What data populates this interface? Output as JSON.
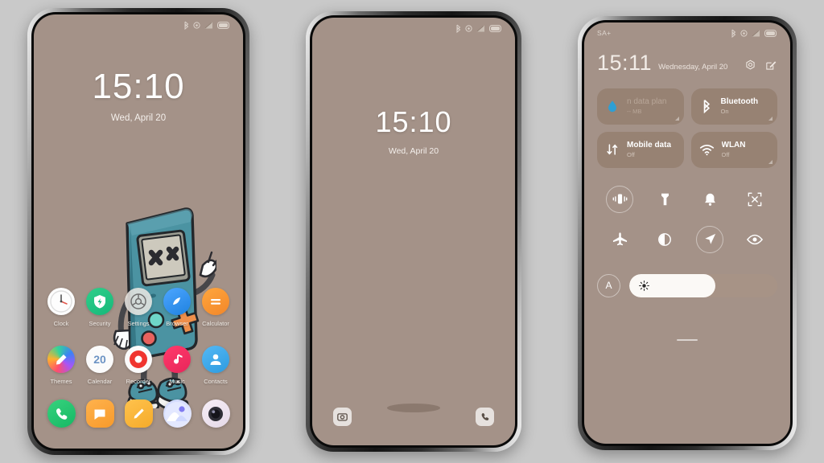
{
  "theme": {
    "page_bg": "#c9c9c9",
    "wallpaper": "#a49288",
    "accent_teal": "#3f8fa0",
    "accent_orange": "#e8823c"
  },
  "phone1": {
    "name": "home-screen",
    "statusbar": {
      "carrier": "",
      "icons": [
        "bluetooth-icon",
        "alarm-icon",
        "signal-icon",
        "battery-icon"
      ]
    },
    "clock": {
      "time": "15:10",
      "date": "Wed, April 20"
    },
    "apps_row1": [
      {
        "label": "Clock",
        "icon": "clock-icon"
      },
      {
        "label": "Security",
        "icon": "security-shield-icon"
      },
      {
        "label": "Settings",
        "icon": "settings-gear-icon"
      },
      {
        "label": "Browser",
        "icon": "browser-compass-icon"
      },
      {
        "label": "Calculator",
        "icon": "calculator-icon"
      }
    ],
    "apps_row2": [
      {
        "label": "Themes",
        "icon": "themes-brush-icon"
      },
      {
        "label": "Calendar",
        "icon": "calendar-icon",
        "day": "20"
      },
      {
        "label": "Recorder",
        "icon": "recorder-icon"
      },
      {
        "label": "Music",
        "icon": "music-note-icon"
      },
      {
        "label": "Contacts",
        "icon": "contacts-person-icon"
      }
    ],
    "dock": [
      {
        "label": "Phone",
        "icon": "phone-handset-icon"
      },
      {
        "label": "Messages",
        "icon": "message-bubble-icon"
      },
      {
        "label": "Notes",
        "icon": "notes-pencil-icon"
      },
      {
        "label": "Gallery",
        "icon": "gallery-mountain-icon"
      },
      {
        "label": "Camera",
        "icon": "camera-lens-icon"
      }
    ]
  },
  "phone2": {
    "name": "lock-screen",
    "statusbar": {
      "carrier": "",
      "icons": [
        "bluetooth-icon",
        "alarm-icon",
        "signal-icon",
        "battery-icon"
      ]
    },
    "clock": {
      "time": "15:10",
      "date": "Wed, April 20"
    },
    "shortcuts": [
      {
        "label": "Camera",
        "icon": "camera-icon"
      },
      {
        "label": "Phone",
        "icon": "phone-handset-icon"
      }
    ]
  },
  "phone3": {
    "name": "control-center",
    "statusbar": {
      "carrier": "SA+",
      "icons": [
        "bluetooth-icon",
        "alarm-icon",
        "signal-icon",
        "battery-icon"
      ]
    },
    "header": {
      "time": "15:11",
      "date": "Wednesday, April 20",
      "settings_icon": "gear-icon",
      "edit_icon": "edit-pencil-icon"
    },
    "tiles": [
      {
        "name": "n data plan",
        "sub": "-- MB",
        "icon": "data-drop-icon",
        "state": "off"
      },
      {
        "name": "Bluetooth",
        "sub": "On",
        "icon": "bluetooth-icon",
        "state": "on"
      },
      {
        "name": "Mobile data",
        "sub": "Off",
        "icon": "mobile-data-arrows-icon",
        "state": "off"
      },
      {
        "name": "WLAN",
        "sub": "Off",
        "icon": "wifi-icon",
        "state": "off"
      }
    ],
    "toggles": [
      {
        "name": "vibrate-icon",
        "active": true
      },
      {
        "name": "flashlight-icon",
        "active": false
      },
      {
        "name": "bell-icon",
        "active": false
      },
      {
        "name": "screenshot-icon",
        "active": false
      },
      {
        "name": "airplane-icon",
        "active": false
      },
      {
        "name": "dark-mode-icon",
        "active": false
      },
      {
        "name": "location-icon",
        "active": true
      },
      {
        "name": "eye-care-icon",
        "active": false
      }
    ],
    "brightness": {
      "auto_label": "A",
      "value": 58,
      "icon": "sun-brightness-icon"
    }
  }
}
